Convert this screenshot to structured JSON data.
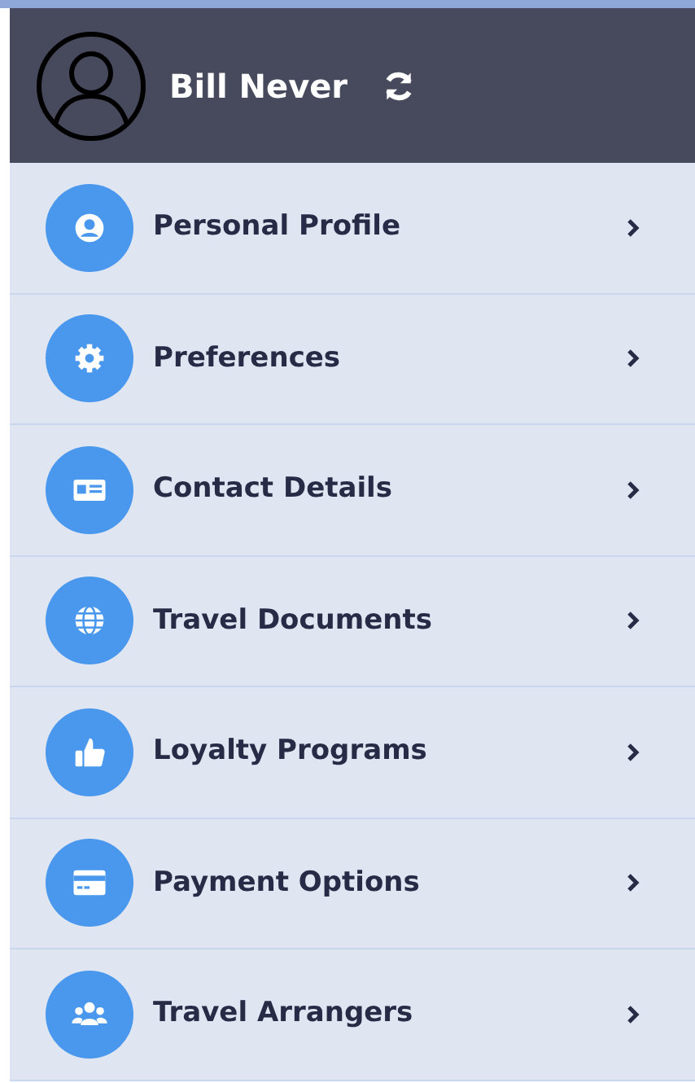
{
  "header": {
    "user_name": "Bill Never"
  },
  "menu_items": [
    {
      "label": "Personal Profile"
    },
    {
      "label": "Preferences"
    },
    {
      "label": "Contact Details"
    },
    {
      "label": "Travel Documents"
    },
    {
      "label": "Loyalty Programs"
    },
    {
      "label": "Payment Options"
    },
    {
      "label": "Travel Arrangers"
    }
  ]
}
